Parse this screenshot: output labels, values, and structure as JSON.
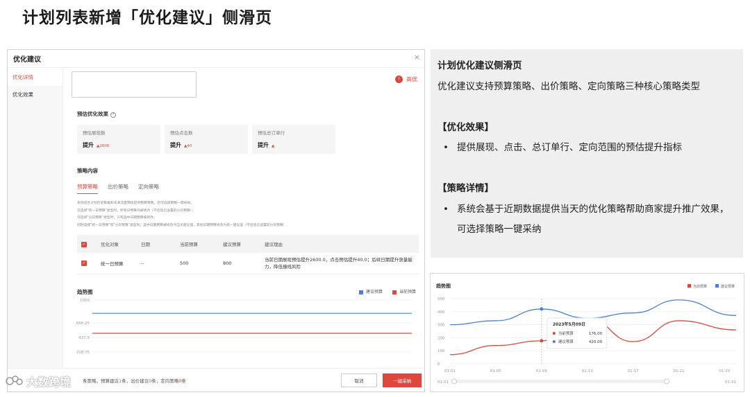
{
  "page_title": "计划列表新增「优化建议」侧滑页",
  "panel": {
    "title": "优化建议",
    "close": "×",
    "sidebar": [
      {
        "label": "优化详情",
        "active": true
      },
      {
        "label": "优化效果",
        "active": false
      }
    ],
    "priority": {
      "icon": "!",
      "label": "高优"
    },
    "effect_title": "预估优化效果",
    "metrics": [
      {
        "label": "预估展现数",
        "value": "提升",
        "delta": "▲2600"
      },
      {
        "label": "预估点击数",
        "value": "提升",
        "delta": "▲40"
      },
      {
        "label": "预估总订单行",
        "value": "提升",
        "delta": "▲"
      }
    ],
    "strategy_title": "策略内容",
    "tabs": [
      {
        "label": "预算策略",
        "active": true
      },
      {
        "label": "出价策略",
        "active": false
      },
      {
        "label": "定向策略",
        "active": false
      }
    ],
    "description": [
      "系统结合计划历史数据和未来流量预估提供预算策略，您可选择策略一键采纳。",
      "仅选择\"统一日预算\"类型时，所有日预算均被修改（不包括已设置的分日预算）；",
      "仅选择\"分日预算\"类型时，只有选中日期预算被修改；",
      "同时选择\"统一日预算\"和\"分日预算\"类型时，选中日期预算被修改为当天建议值，其他日期预算修改为统一建议值（不包括已设置的分日预算）"
    ],
    "table": {
      "headers": [
        "",
        "优化对象",
        "日期",
        "当前预算",
        "建议预算",
        "建议理由"
      ],
      "rows": [
        {
          "checked": "✓",
          "object": "统一日预算",
          "date": "--",
          "current": "500",
          "suggested": "800",
          "reason": "当前日期展现预估提升2600.0，点击预估提升40.0；后续日期提升获量能力，降低撞线风险"
        }
      ]
    },
    "trend_title": "趋势图",
    "footer": {
      "prefix": "条策略，预算建议",
      "budget_count": "1",
      "mid1": "条，出价建议",
      "bid_count": "0",
      "mid2": "条，定向策略",
      "target_count": "0",
      "suffix": "条",
      "cancel": "取消",
      "confirm": "一键采纳"
    }
  },
  "watermark": "大数跨境",
  "note": {
    "title": "计划优化建议侧滑页",
    "intro": "优化建议支持预算策略、出价策略、定向策略三种核心策略类型",
    "effect_head": "【优化效果】",
    "effect_bullet": "提供展现、点击、总订单行、定向范围的预估提升指标",
    "detail_head": "【策略详情】",
    "detail_bullet": "系统会基于近期数据提供当天的优化策略帮助商家提升推广效果，可选择策略一键采纳",
    "bullet_glyph": "•"
  },
  "colors": {
    "accent": "#e0473c",
    "blue": "#4a7fd8",
    "red": "#e0473c"
  },
  "chart_data": [
    {
      "type": "line",
      "title": "趋势图",
      "series": [
        {
          "name": "建议预算",
          "color": "#4a7fd8",
          "values": [
            800,
            800
          ]
        },
        {
          "name": "当前预算",
          "color": "#e0473c",
          "values": [
            500,
            500
          ]
        }
      ],
      "y_ticks": [
        "1000",
        "656.25",
        "437.5",
        "218.75"
      ],
      "ylim": [
        0,
        1000
      ]
    },
    {
      "type": "line",
      "title": "趋势图",
      "x_ticks": [
        "01-01",
        "01-05",
        "01-09",
        "01-13",
        "01-17",
        "01-21",
        "01-25"
      ],
      "y_ticks": [
        0,
        100,
        200,
        300,
        400,
        500
      ],
      "ylim": [
        0,
        500
      ],
      "range_labels": [
        "01-01",
        "01-31"
      ],
      "series": [
        {
          "name": "当前预算",
          "color": "#e0473c",
          "x": [
            0,
            4,
            8,
            12,
            16,
            20,
            25
          ],
          "values": [
            70,
            140,
            176,
            350,
            170,
            330,
            260
          ]
        },
        {
          "name": "建议预算",
          "color": "#4a7fd8",
          "x": [
            0,
            4,
            8,
            12,
            16,
            20,
            25
          ],
          "values": [
            300,
            330,
            420,
            350,
            390,
            490,
            370
          ]
        }
      ],
      "tooltip": {
        "title": "2023年5月09日",
        "rows": [
          {
            "name": "当前预算",
            "value": "176.00",
            "color": "#e0473c"
          },
          {
            "name": "建议预算",
            "value": "420.00",
            "color": "#4a7fd8"
          }
        ]
      }
    }
  ]
}
